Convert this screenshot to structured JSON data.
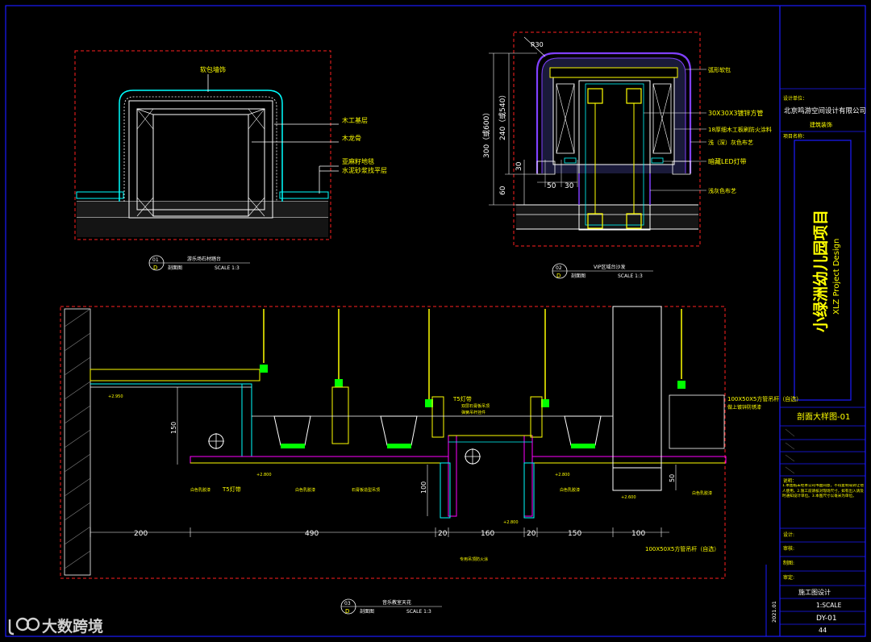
{
  "colors": {
    "frame": "#1a1aff",
    "dashed": "#ff2020",
    "yellow": "#ffff00",
    "white": "#ffffff",
    "cyan": "#00ffff",
    "magenta": "#ff00ff",
    "purple": "#8040ff",
    "green": "#00ff00",
    "gray": "#808080"
  },
  "detail1": {
    "labels": {
      "top": "软包墙饰",
      "base": "木工基层",
      "keel": "木龙骨",
      "floor1": "亚麻籽地毯",
      "floor2": "水泥砂浆找平层"
    },
    "tag_num": "01",
    "tag_letter": "D",
    "title": "游乐场石材踏台",
    "subtitle": "剖面图",
    "scale": "SCALE 1:3"
  },
  "detail2": {
    "dims": {
      "r": "R30",
      "total": "300（或600）",
      "upper": "240（或540）",
      "d30": "30",
      "d60": "60",
      "w50": "50",
      "w30": "30"
    },
    "labels": {
      "l1": "弧形软包",
      "l2": "30X30X3镀锌方管",
      "l3": "18厚细木工板刷防火涂料",
      "l4": "浅（深）灰色布艺",
      "l5": "暗藏LED灯带",
      "l6": "浅灰色布艺"
    },
    "tag_num": "02",
    "tag_letter": "D",
    "title": "VIP区域台沙发",
    "subtitle": "剖面图",
    "scale": "SCALE 1:3"
  },
  "detail3": {
    "dims": {
      "d200": "200",
      "d490": "490",
      "d20a": "20",
      "d160": "160",
      "d20b": "20",
      "d150": "150",
      "d100": "100",
      "v150": "150",
      "v100": "100",
      "v50": "50"
    },
    "labels": {
      "pipe": "100X50X5方管吊杆（自选）",
      "pipe_note": "做上镀锌防锈漆",
      "pipe2": "100X50X5方管吊杆（自选）",
      "t5a": "T5灯带",
      "t5b": "T5灯带",
      "note1": "白色乳胶漆",
      "note2": "白色乳胶漆",
      "note3": "石膏板造型吊顶",
      "note4": "白色乳胶漆",
      "note5": "白色乳胶漆",
      "note6": "专用吊顶防火涂",
      "note7": "双层石膏板吊顶",
      "note8": "弹簧吊杆挂件",
      "lvl1": "+2.950",
      "lvl2": "+2.800",
      "lvl3": "+2.800",
      "lvl4": "+2.600",
      "lvl5": "+2.800"
    },
    "tag_num": "03",
    "tag_letter": "D",
    "title": "音乐教室天花",
    "subtitle": "剖面图",
    "scale": "SCALE 1:3"
  },
  "titleblock": {
    "designer_label": "设计单位：",
    "designer": "北京鸣游空间设计有限公司",
    "designer_en": "建筑装饰",
    "project_label": "项目名称：",
    "project": "小绿洲幼儿园项目",
    "project_en": "XLZ Project Design",
    "drawing_name": "剖面大样图-01",
    "notes_label": "说明：",
    "notes": "1.本图纸未经本公司书面同意，不得复制或转让他人使用。2.施工前请核对现场尺寸，如有出入请及时通知设计单位。3.本图尺寸以毫米为单位。",
    "design_label": "设计:",
    "check_label": "审核:",
    "draw_label": "制图:",
    "approve_label": "审定:",
    "stage": "施工图设计",
    "scale": "1:SCALE",
    "drawing_no": "DY-01",
    "page": "44",
    "date": "2021.01"
  },
  "watermark": {
    "text": "大数跨境"
  }
}
